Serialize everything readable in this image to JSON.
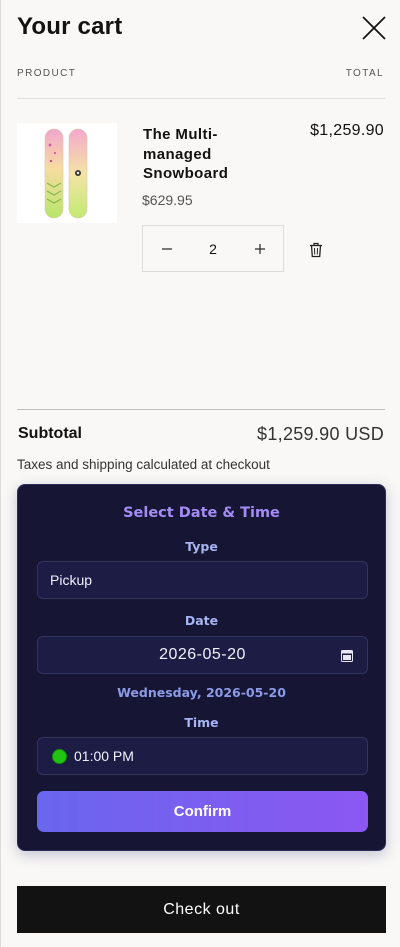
{
  "header": {
    "title": "Your cart",
    "close_icon": "close-icon"
  },
  "columns": {
    "product": "PRODUCT",
    "total": "TOTAL"
  },
  "item": {
    "name": "The Multi-managed Snowboard",
    "unit_price": "$629.95",
    "line_total": "$1,259.90",
    "quantity": "2",
    "decrease_icon": "minus-icon",
    "increase_icon": "plus-icon",
    "remove_icon": "trash-icon"
  },
  "summary": {
    "subtotal_label": "Subtotal",
    "subtotal_value": "$1,259.90 USD",
    "tax_note": "Taxes and shipping calculated at checkout"
  },
  "scheduler": {
    "title": "Select Date & Time",
    "type_label": "Type",
    "type_value": "Pickup",
    "date_label": "Date",
    "date_value": "2026-05-20",
    "weekday": "Wednesday, 2026-05-20",
    "time_label": "Time",
    "time_value": "01:00 PM",
    "confirm_label": "Confirm",
    "colors": {
      "panel": "#161634",
      "accent": "#a58cf5",
      "confirm_from": "#6966ee",
      "confirm_to": "#8c57f2",
      "status": "#22c414"
    }
  },
  "checkout_label": "Check out"
}
